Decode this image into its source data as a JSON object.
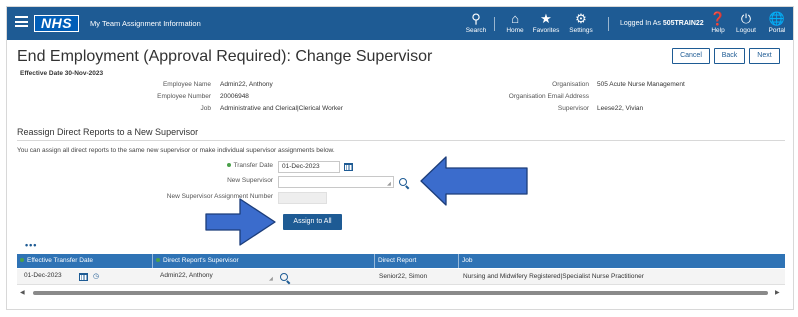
{
  "header": {
    "logo_text": "NHS",
    "app_title": "My Team Assignment Information",
    "nav": [
      {
        "label": "Search",
        "icon": "search-icon"
      },
      {
        "label": "Home",
        "icon": "home-icon"
      },
      {
        "label": "Favorites",
        "icon": "star-icon"
      },
      {
        "label": "Settings",
        "icon": "gear-icon"
      },
      {
        "label": "Help",
        "icon": "help-icon"
      },
      {
        "label": "Logout",
        "icon": "power-icon"
      },
      {
        "label": "Portal",
        "icon": "globe-icon"
      }
    ],
    "logged_prefix": "Logged In As",
    "logged_user": "505TRAIN22"
  },
  "page": {
    "title": "End Employment (Approval Required): Change Supervisor",
    "effective_date": "Effective Date 30-Nov-2023",
    "buttons": {
      "cancel": "Cancel",
      "back": "Back",
      "next": "Next"
    }
  },
  "employee": {
    "name_label": "Employee Name",
    "name": "Admin22, Anthony",
    "number_label": "Employee Number",
    "number": "20006948",
    "job_label": "Job",
    "job": "Administrative and Clerical|Clerical Worker",
    "org_label": "Organisation",
    "org": "505 Acute Nurse Management",
    "org_email_label": "Organisation Email Address",
    "org_email": "",
    "supervisor_label": "Supervisor",
    "supervisor": "Leese22, Vivian"
  },
  "reassign": {
    "section_title": "Reassign Direct Reports to a New Supervisor",
    "instruction": "You can assign all direct reports to the same new supervisor or make individual supervisor assignments below.",
    "transfer_date_label": "Transfer Date",
    "transfer_date": "01-Dec-2023",
    "new_supervisor_label": "New Supervisor",
    "new_supervisor": "",
    "new_sup_assign_label": "New Supervisor Assignment Number",
    "new_sup_assign": "",
    "assign_all": "Assign to All"
  },
  "table": {
    "more": "•••",
    "columns": [
      "Effective Transfer Date",
      "Direct Report's Supervisor",
      "Direct Report",
      "Job"
    ],
    "rows": [
      {
        "date": "01-Dec-2023",
        "supervisor": "Admin22, Anthony",
        "report": "Senior22, Simon",
        "job": "Nursing and Midwifery Registered|Specialist Nurse Practitioner"
      }
    ]
  },
  "colors": {
    "brand": "#1e5b94",
    "table_header": "#2f73b5",
    "arrow": "#3b6ccc",
    "required": "#4aa04a"
  }
}
